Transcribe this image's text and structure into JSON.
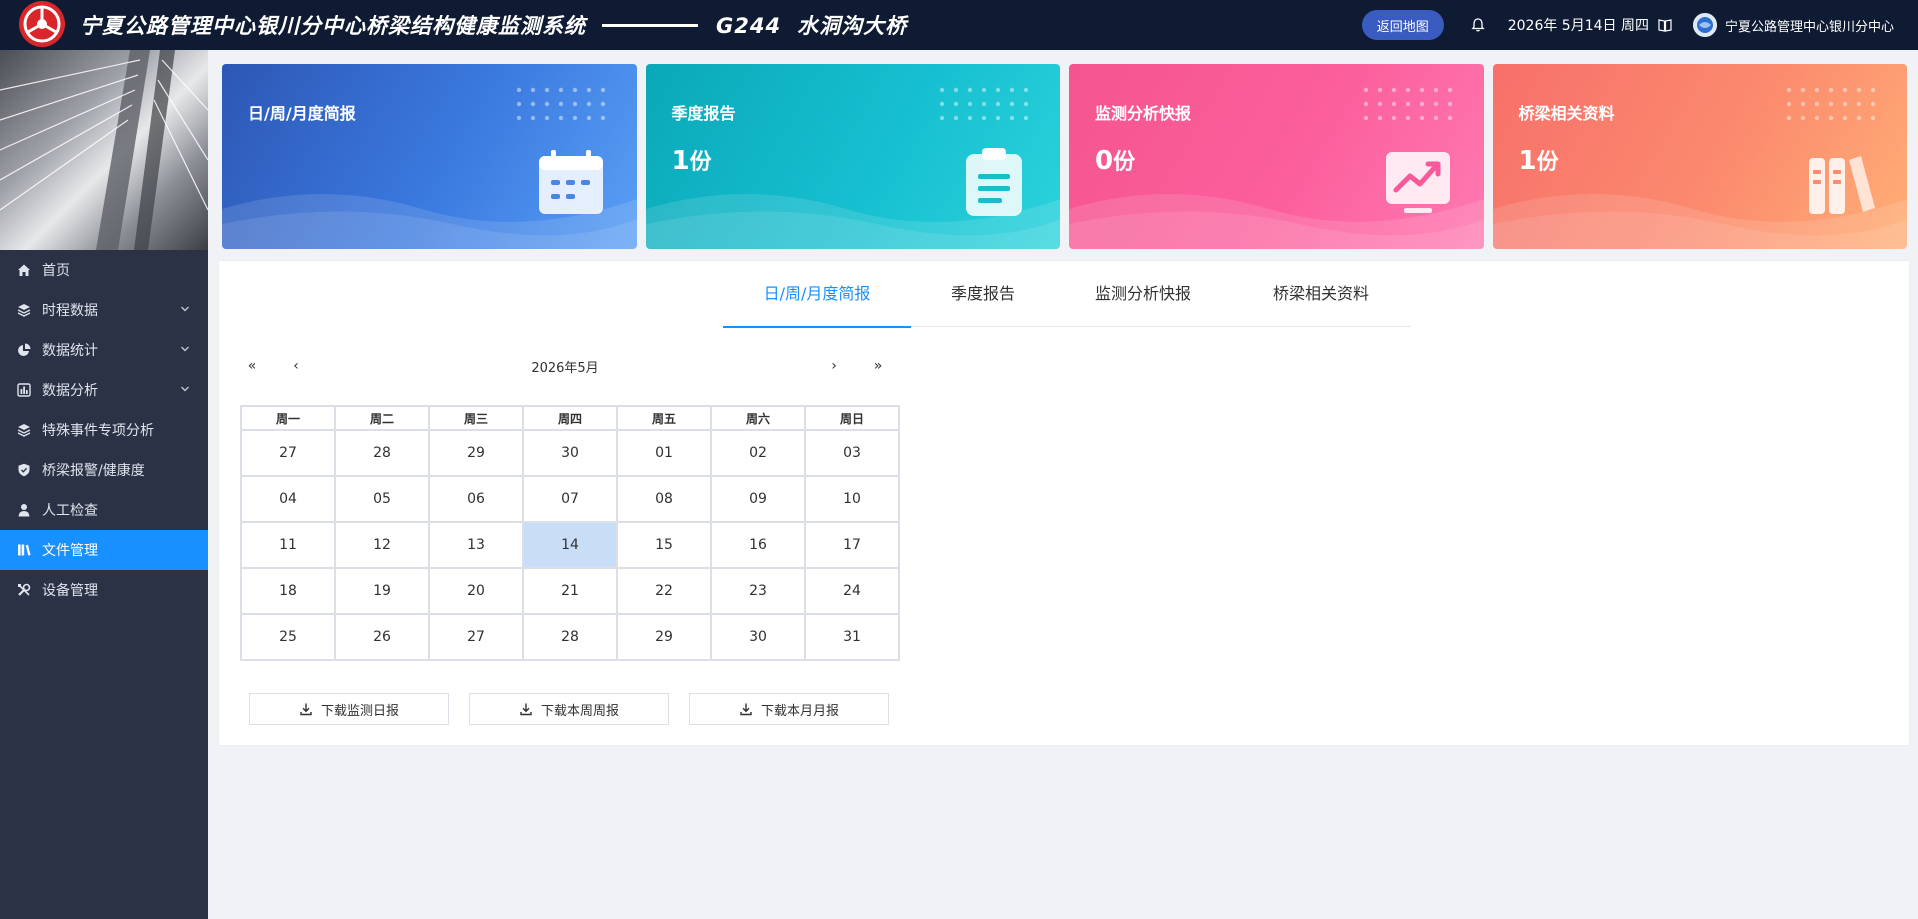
{
  "header": {
    "system_title": "宁夏公路管理中心银川分中心桥梁结构健康监测系统",
    "road": "G244",
    "bridge": "水洞沟大桥",
    "back_button": "返回地图",
    "date": "2026年 5月14日 周四",
    "org": "宁夏公路管理中心银川分中心"
  },
  "sidebar": {
    "items": [
      {
        "label": "首页",
        "icon": "home-icon",
        "expandable": false
      },
      {
        "label": "时程数据",
        "icon": "layers-icon",
        "expandable": true
      },
      {
        "label": "数据统计",
        "icon": "pie-chart-icon",
        "expandable": true
      },
      {
        "label": "数据分析",
        "icon": "bar-chart-icon",
        "expandable": true
      },
      {
        "label": "特殊事件专项分析",
        "icon": "layers-icon",
        "expandable": false
      },
      {
        "label": "桥梁报警/健康度",
        "icon": "shield-icon",
        "expandable": false
      },
      {
        "label": "人工检查",
        "icon": "user-icon",
        "expandable": false
      },
      {
        "label": "文件管理",
        "icon": "books-icon",
        "expandable": false,
        "active": true
      },
      {
        "label": "设备管理",
        "icon": "tools-icon",
        "expandable": false
      }
    ]
  },
  "cards": [
    {
      "title": "日/周/月度简报",
      "count": "",
      "unit": "",
      "icon": "calendar-icon",
      "color": "#3b7ae0"
    },
    {
      "title": "季度报告",
      "count": "1",
      "unit": "份",
      "icon": "clipboard-icon",
      "color": "#16bfd0"
    },
    {
      "title": "监测分析快报",
      "count": "0",
      "unit": "份",
      "icon": "trend-chart-icon",
      "color": "#fb5f9c"
    },
    {
      "title": "桥梁相关资料",
      "count": "1",
      "unit": "份",
      "icon": "books-icon",
      "color": "#fb8a6e"
    }
  ],
  "tabs": [
    {
      "label": "日/周/月度简报",
      "active": true
    },
    {
      "label": "季度报告",
      "active": false
    },
    {
      "label": "监测分析快报",
      "active": false
    },
    {
      "label": "桥梁相关资料",
      "active": false
    }
  ],
  "calendar": {
    "title": "2026年5月",
    "prev_year": "«",
    "prev_month": "‹",
    "next_month": "›",
    "next_year": "»",
    "weekdays": [
      "周一",
      "周二",
      "周三",
      "周四",
      "周五",
      "周六",
      "周日"
    ],
    "weeks": [
      [
        "27",
        "28",
        "29",
        "30",
        "01",
        "02",
        "03"
      ],
      [
        "04",
        "05",
        "06",
        "07",
        "08",
        "09",
        "10"
      ],
      [
        "11",
        "12",
        "13",
        "14",
        "15",
        "16",
        "17"
      ],
      [
        "18",
        "19",
        "20",
        "21",
        "22",
        "23",
        "24"
      ],
      [
        "25",
        "26",
        "27",
        "28",
        "29",
        "30",
        "31"
      ]
    ],
    "selected": "14"
  },
  "downloads": {
    "daily": "下载监测日报",
    "weekly": "下载本周周报",
    "monthly": "下载本月月报"
  },
  "colors": {
    "header_bg": "#0f1b33",
    "sidebar_bg": "#2b3245",
    "accent": "#1890ff",
    "logo_red": "#d9262a"
  }
}
